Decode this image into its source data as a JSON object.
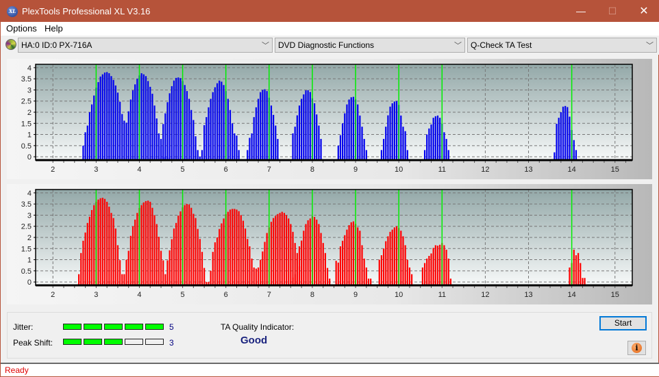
{
  "window": {
    "title": "PlexTools Professional XL V3.16",
    "app_icon": "XL",
    "controls": {
      "minimize": "—",
      "maximize": "☐",
      "close": "✕"
    }
  },
  "menu": [
    "Options",
    "Help"
  ],
  "toolbar": {
    "device": {
      "icon": "disc-icon",
      "value": "HA:0 ID:0  PX-716A"
    },
    "function_group": {
      "value": "DVD Diagnostic Functions"
    },
    "test": {
      "value": "Q-Check TA Test"
    }
  },
  "results": {
    "jitter_label": "Jitter:",
    "jitter_value": 5,
    "jitter_max": 5,
    "peak_shift_label": "Peak Shift:",
    "peak_shift_value": 3,
    "peak_shift_max": 5,
    "ta_quality_label": "TA Quality Indicator:",
    "ta_quality_value": "Good"
  },
  "buttons": {
    "start": "Start",
    "info": "i"
  },
  "status": "Ready",
  "colors": {
    "title_bar": "#b6533a",
    "inner_track": "#0000ee",
    "outer_track": "#ff0000",
    "marker": "#00ee00",
    "gauge_on": "#00ff00"
  },
  "chart_data": [
    {
      "type": "bar",
      "name": "inner-track-ta",
      "color": "#0000ee",
      "xlim": [
        1.6,
        15.4
      ],
      "ylim": [
        -0.15,
        4.15
      ],
      "xticks": [
        2,
        3,
        4,
        5,
        6,
        7,
        8,
        9,
        10,
        11,
        12,
        13,
        14,
        15
      ],
      "yticks": [
        0,
        0.5,
        1,
        1.5,
        2,
        2.5,
        3,
        3.5,
        4
      ],
      "ytick_labels": [
        "0",
        "0.5",
        "1",
        "1.5",
        "2",
        "2.5",
        "3",
        "3.5",
        "4"
      ],
      "markers": [
        3,
        4,
        5,
        6,
        7,
        8,
        9,
        10,
        11,
        14
      ],
      "peaks": [
        {
          "start": 2.7,
          "values": [
            0.5,
            1.1,
            1.4,
            2.0,
            2.35,
            2.75,
            3.1,
            3.35,
            3.6,
            3.7,
            3.78,
            3.8,
            3.75,
            3.62,
            3.45,
            3.2,
            2.88,
            2.47,
            1.92,
            1.62,
            1.53,
            2.04,
            2.57,
            2.98,
            3.25,
            3.5,
            3.65,
            3.75,
            3.7,
            3.62,
            3.4,
            3.14,
            2.83,
            2.3,
            1.72,
            1.05,
            0.5,
            0,
            0,
            0
          ]
        },
        {
          "start": 4.5,
          "values": [
            0.8,
            1.47,
            1.95,
            2.45,
            2.85,
            3.17,
            3.42,
            3.54,
            3.56,
            3.53,
            3.4,
            3.22,
            2.95,
            2.6,
            2.1,
            1.65,
            0.92,
            0.3,
            0,
            0.3,
            1.42,
            1.78,
            2.22,
            2.6,
            2.9,
            3.12,
            3.3,
            3.42,
            3.37,
            3.22,
            2.95,
            2.6,
            2.1,
            1.5,
            1.05,
            0.95,
            0.3
          ]
        },
        {
          "start": 6.5,
          "values": [
            0.3,
            0.85,
            1.05,
            1.78,
            2.22,
            2.6,
            2.9,
            3.0,
            3.03,
            2.95,
            2.65,
            2.3,
            1.88,
            1.4,
            0.8
          ]
        },
        {
          "start": 7.55,
          "values": [
            1.05,
            1.35,
            1.86,
            2.3,
            2.6,
            2.8,
            2.98,
            2.99,
            2.91,
            2.62,
            2.4,
            1.9,
            1.4,
            0.8
          ]
        },
        {
          "start": 8.6,
          "values": [
            0.5,
            0.97,
            1.5,
            1.95,
            2.35,
            2.57,
            2.67,
            2.69,
            2.57,
            2.35,
            1.85,
            1.35,
            0.8,
            0.3
          ]
        },
        {
          "start": 9.6,
          "values": [
            0.3,
            0.8,
            1.35,
            1.86,
            2.25,
            2.4,
            2.48,
            2.5,
            2.33,
            1.85,
            1.35,
            1.15,
            0.3
          ]
        },
        {
          "start": 10.6,
          "values": [
            0.3,
            1.0,
            1.27,
            1.45,
            1.75,
            1.82,
            1.85,
            1.75,
            1.48,
            1.1,
            0.8,
            0.3
          ]
        },
        {
          "start": 13.6,
          "values": [
            0.2,
            1.48,
            1.75,
            2.0,
            2.25,
            2.28,
            2.23,
            1.8,
            1.2,
            0.75,
            0.3
          ]
        }
      ]
    },
    {
      "type": "bar",
      "name": "outer-track-ta",
      "color": "#ff0000",
      "xlim": [
        1.6,
        15.4
      ],
      "ylim": [
        -0.15,
        4.15
      ],
      "xticks": [
        2,
        3,
        4,
        5,
        6,
        7,
        8,
        9,
        10,
        11,
        12,
        13,
        14,
        15
      ],
      "yticks": [
        0,
        0.5,
        1,
        1.5,
        2,
        2.5,
        3,
        3.5,
        4
      ],
      "ytick_labels": [
        "0",
        "0.5",
        "1",
        "1.5",
        "2",
        "2.5",
        "3",
        "3.5",
        "4"
      ],
      "markers": [
        3,
        4,
        5,
        6,
        7,
        8,
        9,
        10,
        11,
        14
      ],
      "peaks": [
        {
          "start": 2.6,
          "values": [
            0.35,
            1.3,
            1.85,
            2.22,
            2.65,
            2.93,
            3.23,
            3.45,
            3.6,
            3.7,
            3.76,
            3.78,
            3.73,
            3.6,
            3.38,
            3.1,
            2.87,
            2.4,
            1.65,
            0.98,
            0.35,
            0.35,
            1.0,
            1.4,
            2.07,
            2.5,
            2.8,
            3.1,
            3.32,
            3.45,
            3.57,
            3.63,
            3.65,
            3.6,
            3.33,
            3.0,
            2.6,
            2.03,
            1.4,
            0.97,
            0.35,
            0.97,
            1.42,
            1.92,
            2.4,
            2.65,
            2.98,
            3.17,
            3.35,
            3.45,
            3.5,
            3.48,
            3.33,
            3.06,
            2.87,
            2.38,
            1.93,
            1.35,
            0.63,
            0.0,
            0.0,
            0.5,
            1.35,
            1.78,
            2.0,
            2.38,
            2.63,
            2.85,
            3.04,
            3.15,
            3.25,
            3.28,
            3.28,
            3.25,
            3.18,
            3.0,
            2.75,
            2.4,
            1.93,
            1.6,
            1.05,
            0.65,
            0.6,
            0.65,
            1.0,
            1.37,
            1.8,
            2.2,
            2.45,
            2.7,
            2.87,
            2.97,
            3.05,
            3.1,
            3.15,
            3.1,
            3.0,
            2.85,
            2.6,
            2.25,
            1.75,
            1.3,
            0.7
          ]
        },
        {
          "start": 7.55,
          "values": [
            0.2,
            0.35,
            1.05,
            1.6,
            1.86,
            2.3,
            2.6,
            2.77,
            2.85,
            2.95,
            2.92,
            2.8,
            2.6,
            2.2,
            1.75,
            1.3,
            0.63,
            0.15
          ]
        },
        {
          "start": 8.55,
          "values": [
            0.95,
            0.87,
            1.6,
            1.85,
            2.1,
            2.35,
            2.55,
            2.68,
            2.72,
            2.6,
            2.45,
            2.3,
            1.65,
            1.05,
            0.65,
            0.15,
            0.15
          ]
        },
        {
          "start": 9.55,
          "values": [
            1.0,
            1.2,
            1.5,
            1.83,
            2.05,
            2.25,
            2.35,
            2.45,
            2.5,
            2.42,
            2.3,
            2.05,
            1.65,
            1.0,
            0.65,
            0.35
          ]
        },
        {
          "start": 10.55,
          "values": [
            0.65,
            0.85,
            1.05,
            1.17,
            1.28,
            1.53,
            1.65,
            1.63,
            1.67,
            1.75,
            1.65,
            1.45,
            1.05,
            0.15
          ]
        },
        {
          "start": 13.95,
          "values": [
            0.65,
            0.85,
            1.45,
            1.2,
            1.3,
            0.85,
            0.18,
            0.18
          ]
        }
      ]
    }
  ]
}
